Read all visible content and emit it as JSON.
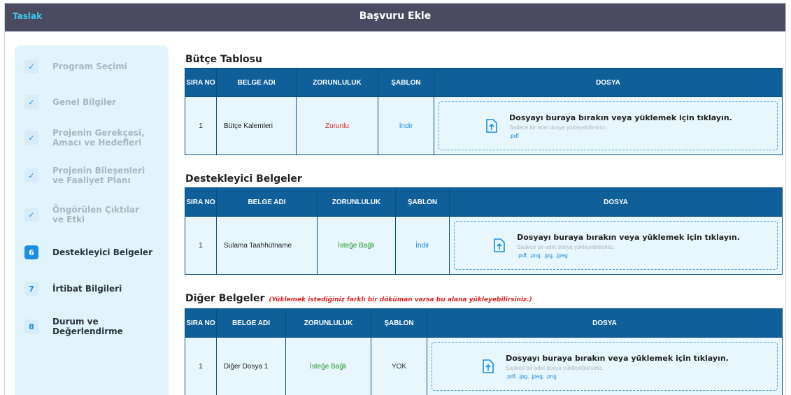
{
  "header": {
    "status": "Taslak",
    "title": "Başvuru Ekle"
  },
  "steps": [
    {
      "badge": "✓",
      "label": "Program Seçimi",
      "state": "done"
    },
    {
      "badge": "✓",
      "label": "Genel Bilgiler",
      "state": "done"
    },
    {
      "badge": "✓",
      "label": "Projenin Gerekçesi, Amacı ve Hedefleri",
      "state": "done"
    },
    {
      "badge": "✓",
      "label": "Projenin Bileşenleri ve Faaliyet Planı",
      "state": "done"
    },
    {
      "badge": "✓",
      "label": "Öngörülen Çıktılar ve Etki",
      "state": "done"
    },
    {
      "badge": "6",
      "label": "Destekleyici Belgeler",
      "state": "active"
    },
    {
      "badge": "7",
      "label": "İrtibat Bilgileri",
      "state": "pending"
    },
    {
      "badge": "8",
      "label": "Durum ve Değerlendirme",
      "state": "pending"
    }
  ],
  "columns": {
    "sira": "SIRA NO",
    "belge": "BELGE ADI",
    "zorunluluk": "ZORUNLULUK",
    "sablon": "ŞABLON",
    "dosya": "DOSYA"
  },
  "upload": {
    "main": "Dosyayı buraya bırakın veya yüklemek için tıklayın.",
    "sub": "Sadece bir adet dosya yükleyebilirsiniz."
  },
  "sections": [
    {
      "title": "Bütçe Tablosu",
      "note": "",
      "row": {
        "no": "1",
        "name": "Bütçe Kalemleri",
        "requirement": "Zorunlu",
        "template": "İndir",
        "extensions": ".pdf"
      }
    },
    {
      "title": "Destekleyici Belgeler",
      "note": "",
      "row": {
        "no": "1",
        "name": "Sulama Taahhütname",
        "requirement": "İsteğe Bağlı",
        "template": "İndir",
        "extensions": ".pdf, .png, .jpg, .jpeg"
      }
    },
    {
      "title": "Diğer Belgeler",
      "note": "(Yüklemek istediğiniz farklı bir döküman varsa bu alana yükleyebilirsiniz.)",
      "row": {
        "no": "1",
        "name": "Diğer Dosya 1",
        "requirement": "İsteğe Bağlı",
        "template": "YOK",
        "extensions": ".pdf, .jpg, .jpeg, .png"
      }
    }
  ],
  "colors": {
    "header_bg": "#4a4b60",
    "table_header": "#0e5f9a",
    "accent": "#1a8ee0",
    "required": "#e02020",
    "optional": "#1f9a2a"
  }
}
